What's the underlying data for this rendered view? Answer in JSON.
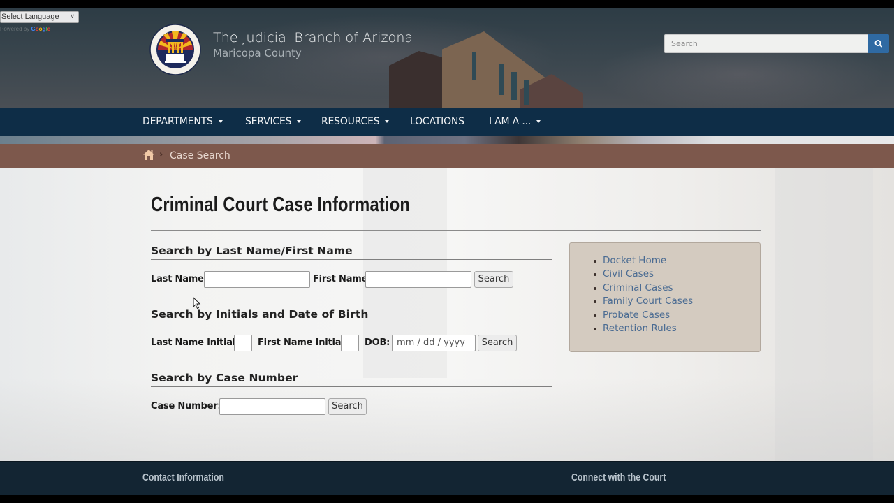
{
  "language_widget": {
    "select_value": "Select Language",
    "powered_by": "Powered by",
    "provider": "Google"
  },
  "header": {
    "title": "The Judicial Branch of Arizona",
    "subtitle": "Maricopa County",
    "search_placeholder": "Search",
    "search_icon": "search-icon"
  },
  "nav": {
    "items": [
      {
        "label": "DEPARTMENTS",
        "dropdown": true
      },
      {
        "label": "SERVICES",
        "dropdown": true
      },
      {
        "label": "RESOURCES",
        "dropdown": true
      },
      {
        "label": "LOCATIONS",
        "dropdown": false
      },
      {
        "label": "I AM A ...",
        "dropdown": true
      }
    ]
  },
  "breadcrumb": {
    "home_icon": "home-icon",
    "separator": "›",
    "current": "Case Search"
  },
  "main": {
    "page_title": "Criminal Court Case Information",
    "sections": [
      {
        "heading": "Search by Last Name/First Name",
        "fields": [
          {
            "label": "Last Name:",
            "value": ""
          },
          {
            "label": "First Name:",
            "value": ""
          }
        ],
        "button": "Search"
      },
      {
        "heading": "Search by Initials and Date of Birth",
        "fields": [
          {
            "label": "Last Name Initial:",
            "value": ""
          },
          {
            "label": "First Name Initial:",
            "value": ""
          },
          {
            "label": "DOB:",
            "value": "",
            "placeholder": "mm / dd / yyyy"
          }
        ],
        "button": "Search"
      },
      {
        "heading": "Search by Case Number",
        "fields": [
          {
            "label": "Case Number:",
            "value": ""
          }
        ],
        "button": "Search"
      }
    ]
  },
  "sidebar": {
    "links": [
      "Docket Home",
      "Civil Cases",
      "Criminal Cases",
      "Family Court Cases",
      "Probate Cases",
      "Retention Rules"
    ]
  },
  "footer": {
    "col1_heading": "Contact Information",
    "col2_heading": "Connect with the Court"
  },
  "colors": {
    "nav_bg": "#0e2d47",
    "breadcrumb_bg": "#7d584c",
    "search_button": "#2f6aa3",
    "link": "#4a6b92",
    "sidebar_bg": "#d4cbc0",
    "footer_bg": "#132533"
  }
}
